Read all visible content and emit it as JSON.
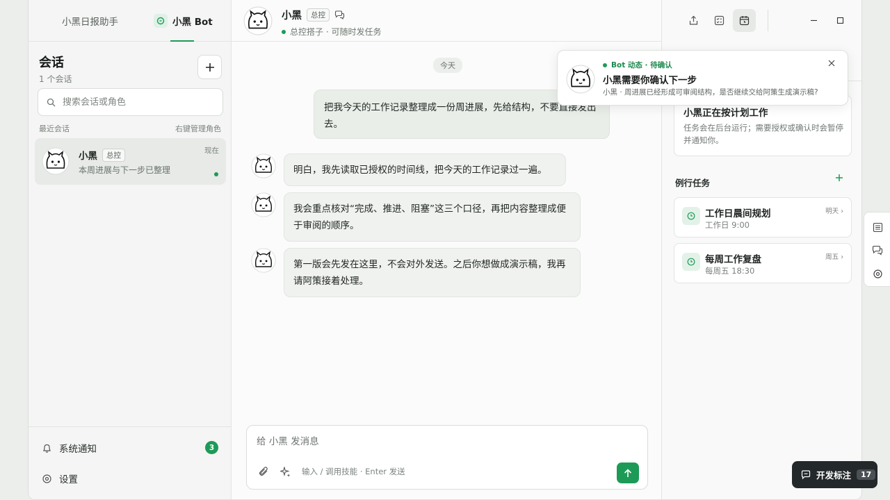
{
  "sidebar": {
    "tabs": [
      {
        "label": "小黑日报助手"
      },
      {
        "label": "小黑 Bot"
      }
    ],
    "title": "会话",
    "subtitle": "1 个会话",
    "search_placeholder": "搜索会话或角色",
    "recent_label": "最近会话",
    "recent_hint": "右键管理角色",
    "conversation": {
      "name": "小黑",
      "tag": "总控",
      "preview": "本周进展与下一步已整理",
      "time": "现在"
    },
    "bottom": {
      "notifications_label": "系统通知",
      "notifications_count": "3",
      "settings_label": "设置"
    }
  },
  "chat": {
    "header": {
      "name": "小黑",
      "tag": "总控",
      "status": "总控搭子 · 可随时发任务"
    },
    "date_label": "今天",
    "messages": [
      {
        "role": "user",
        "text": "把我今天的工作记录整理成一份周进展，先给结构，不要直接发出去。"
      },
      {
        "role": "bot",
        "text": "明白，我先读取已授权的时间线，把今天的工作记录过一遍。"
      },
      {
        "role": "bot",
        "text": "我会重点核对“完成、推进、阻塞”这三个口径，再把内容整理成便于审阅的顺序。"
      },
      {
        "role": "bot",
        "text": "第一版会先发在这里，不会对外发送。之后你想做成演示稿，我再请阿策接着处理。"
      }
    ],
    "composer": {
      "placeholder": "给 小黑 发消息",
      "hint": "输入 / 调用技能 · Enter 发送"
    }
  },
  "panel": {
    "task_card": {
      "title": "小黑正在按计划工作",
      "desc": "任务会在后台运行；需要授权或确认时会暂停并通知你。"
    },
    "routine_title": "例行任务",
    "routines": [
      {
        "title": "工作日晨间规划",
        "sub": "工作日 9:00",
        "when": "明天 ›"
      },
      {
        "title": "每周工作复盘",
        "sub": "每周五 18:30",
        "when": "周五 ›"
      }
    ]
  },
  "toast": {
    "tag": "Bot 动态 · 待确认",
    "title": "小黑需要你确认下一步",
    "body": "小黑 · 周进展已经形成可审阅结构，是否继续交给阿策生成演示稿?"
  },
  "dev_button": {
    "label": "开发标注",
    "count": "17"
  },
  "colors": {
    "accent": "#1e9a57",
    "background": "#fafbfa",
    "bubble_user": "#e9eee9",
    "bubble_bot": "#f0f2f0"
  }
}
